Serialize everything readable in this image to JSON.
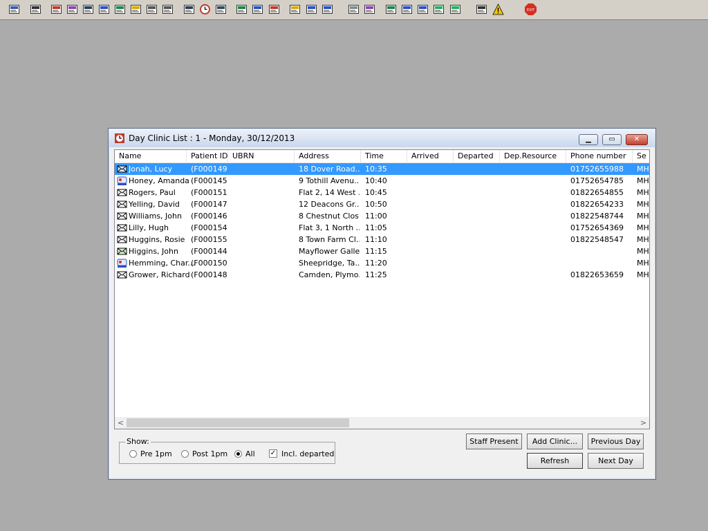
{
  "toolbar_icons": [
    "user-search-icon",
    "printer-icon",
    "book-icon",
    "notepad-edit-icon",
    "folder-view-icon",
    "letter-m-icon",
    "person-icon",
    "clipboard-icon",
    "flag-icon",
    "flag-alt-icon",
    "envelope-icon",
    "clock-icon",
    "monitor-icon",
    "chart-icon",
    "chat-icon",
    "compass-icon",
    "notes-icon",
    "car-icon",
    "transport-icon",
    "document-icon",
    "bar-chart-icon",
    "globe-icon",
    "check-list-icon",
    "check-arrow-icon",
    "green-check-icon",
    "green-arrow-icon",
    "swap-arrows-icon",
    "warning-icon",
    "exit-icon"
  ],
  "window": {
    "title": "Day Clinic List : 1 - Monday, 30/12/2013",
    "minimize_glyph": "▁",
    "maximize_glyph": "▭",
    "close_glyph": "✕"
  },
  "list": {
    "columns": [
      "Name",
      "Patient ID",
      "UBRN",
      "Address",
      "Time",
      "Arrived",
      "Departed",
      "Dep.Resource",
      "Phone number",
      "Se"
    ],
    "rows": [
      {
        "icon": "envelope-arrived-icon",
        "name": "Jonah, Lucy",
        "pid": "(F000149)",
        "ubrn": "",
        "address": "18 Dover Road...",
        "time": "10:35",
        "arrived": "",
        "departed": "",
        "dep": "",
        "phone": "01752655988",
        "se": "MH",
        "selected": true
      },
      {
        "icon": "transport-icon",
        "name": "Honey, Amanda",
        "pid": "(F000145)",
        "ubrn": "",
        "address": "9 Tothill Avenu...",
        "time": "10:40",
        "arrived": "",
        "departed": "",
        "dep": "",
        "phone": "01752654785",
        "se": "MH",
        "selected": false
      },
      {
        "icon": "envelope-icon",
        "name": "Rogers, Paul",
        "pid": "(F000151)",
        "ubrn": "",
        "address": "Flat 2, 14 West ...",
        "time": "10:45",
        "arrived": "",
        "departed": "",
        "dep": "",
        "phone": "01822654855",
        "se": "MH",
        "selected": false
      },
      {
        "icon": "envelope-icon",
        "name": "Yelling, David",
        "pid": "(F000147)",
        "ubrn": "",
        "address": "12 Deacons Gr...",
        "time": "10:50",
        "arrived": "",
        "departed": "",
        "dep": "",
        "phone": "01822654233",
        "se": "MH",
        "selected": false
      },
      {
        "icon": "envelope-icon",
        "name": "Williams, John",
        "pid": "(F000146)",
        "ubrn": "",
        "address": "8 Chestnut Clos...",
        "time": "11:00",
        "arrived": "",
        "departed": "",
        "dep": "",
        "phone": "01822548744",
        "se": "MH",
        "selected": false
      },
      {
        "icon": "envelope-icon",
        "name": "Lilly, Hugh",
        "pid": "(F000154)",
        "ubrn": "",
        "address": "Flat 3, 1 North ...",
        "time": "11:05",
        "arrived": "",
        "departed": "",
        "dep": "",
        "phone": "01752654369",
        "se": "MH",
        "selected": false
      },
      {
        "icon": "envelope-icon",
        "name": "Huggins, Rosie",
        "pid": "(F000155)",
        "ubrn": "",
        "address": "8 Town Farm Cl...",
        "time": "11:10",
        "arrived": "",
        "departed": "",
        "dep": "",
        "phone": "01822548547",
        "se": "MH",
        "selected": false
      },
      {
        "icon": "envelope-green-icon",
        "name": "Higgins, John",
        "pid": "(F000144)",
        "ubrn": "",
        "address": "Mayflower Galle...",
        "time": "11:15",
        "arrived": "",
        "departed": "",
        "dep": "",
        "phone": "",
        "se": "MH",
        "selected": false
      },
      {
        "icon": "transport-icon",
        "name": "Hemming, Char...",
        "pid": "(F000150)",
        "ubrn": "",
        "address": "Sheepridge, Ta...",
        "time": "11:20",
        "arrived": "",
        "departed": "",
        "dep": "",
        "phone": "",
        "se": "MH",
        "selected": false
      },
      {
        "icon": "envelope-icon",
        "name": "Grower, Richard",
        "pid": "(F000148)",
        "ubrn": "",
        "address": "Camden, Plymo...",
        "time": "11:25",
        "arrived": "",
        "departed": "",
        "dep": "",
        "phone": "01822653659",
        "se": "MH",
        "selected": false
      }
    ],
    "scroll_left": "<",
    "scroll_right": ">"
  },
  "show": {
    "legend": "Show:",
    "pre": "Pre 1pm",
    "post": "Post 1pm",
    "all": "All",
    "incl_departed": "Incl. departed",
    "selected": "All",
    "incl_departed_checked": true
  },
  "buttons": {
    "staff_present": "Staff Present",
    "add_clinic": "Add Clinic...",
    "previous_day": "Previous Day",
    "refresh": "Refresh",
    "next_day": "Next Day"
  }
}
